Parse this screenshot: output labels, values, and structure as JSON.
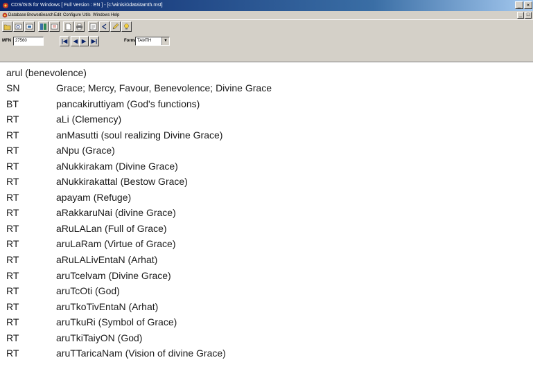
{
  "window": {
    "title": "CDS/ISIS for Windows [ Full Version : EN ] - [c:\\winisis\\data\\tamth.mst]",
    "controls": [
      "_",
      "×"
    ]
  },
  "menubar": {
    "items": [
      "Database",
      "Browse",
      "Search",
      "Edit",
      "Configure",
      "Utils",
      "Windows",
      "Help"
    ]
  },
  "navbar": {
    "mfn_label": "MFN",
    "mfn_value": "27560",
    "format_label": "Format",
    "format_value": "TAMTH"
  },
  "record": {
    "heading": "arul (benevolence)",
    "entries": [
      {
        "code": "SN",
        "term": "Grace; Mercy, Favour, Benevolence; Divine Grace"
      },
      {
        "code": "BT",
        "term": "pancakiruttiyam (God's functions)"
      },
      {
        "code": "RT",
        "term": "aLi (Clemency)"
      },
      {
        "code": "RT",
        "term": "anMasutti (soul realizing Divine Grace)"
      },
      {
        "code": "RT",
        "term": "aNpu (Grace)"
      },
      {
        "code": "RT",
        "term": "aNukkirakam (Divine Grace)"
      },
      {
        "code": "RT",
        "term": "aNukkirakattal (Bestow Grace)"
      },
      {
        "code": "RT",
        "term": "apayam (Refuge)"
      },
      {
        "code": "RT",
        "term": "aRakkaruNai (divine Grace)"
      },
      {
        "code": "RT",
        "term": "aRuLALan (Full of Grace)"
      },
      {
        "code": "RT",
        "term": "aruLaRam (Virtue of Grace)"
      },
      {
        "code": "RT",
        "term": "aRuLALivEntaN (Arhat)"
      },
      {
        "code": "RT",
        "term": "aruTcelvam (Divine Grace)"
      },
      {
        "code": "RT",
        "term": "aruTcOti (God)"
      },
      {
        "code": "RT",
        "term": "aruTkoTivEntaN (Arhat)"
      },
      {
        "code": "RT",
        "term": "aruTkuRi (Symbol of Grace)"
      },
      {
        "code": "RT",
        "term": "aruTkiTaiyON (God)"
      },
      {
        "code": "RT",
        "term": "aruTTaricaNam (Vision of divine Grace)"
      }
    ]
  }
}
